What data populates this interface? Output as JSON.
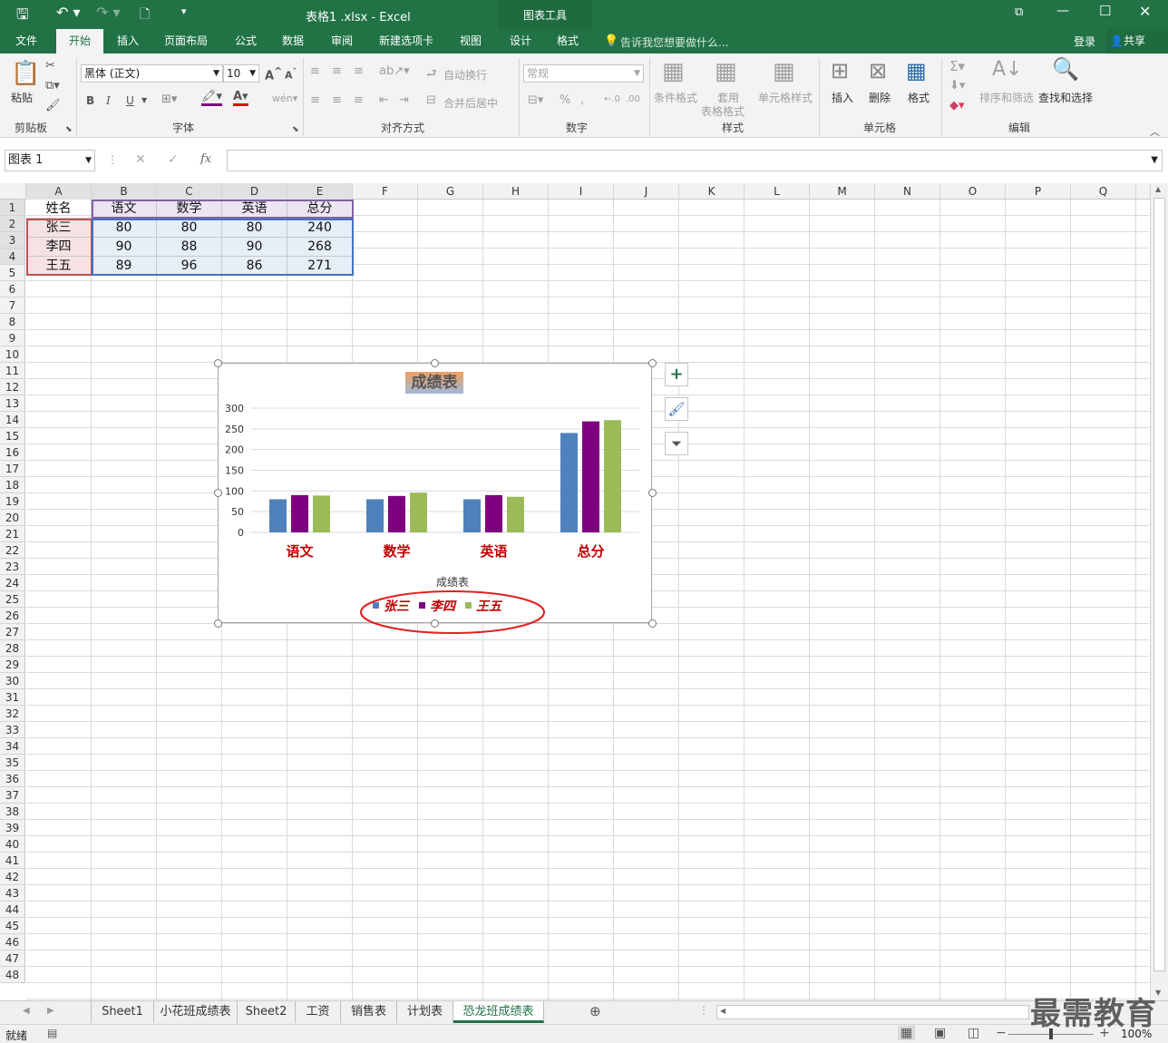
{
  "window": {
    "title": "表格1 .xlsx - Excel",
    "context_tools": "图表工具",
    "signin": "登录",
    "share": "共享"
  },
  "tabs": [
    "文件",
    "开始",
    "插入",
    "页面布局",
    "公式",
    "数据",
    "审阅",
    "新建选项卡",
    "视图",
    "设计",
    "格式"
  ],
  "tell_me": "告诉我您想要做什么...",
  "ribbon": {
    "paste": "粘贴",
    "clipboard": "剪贴板",
    "font_name": "黑体 (正文)",
    "font_size": "10",
    "font": "字体",
    "wrap": "自动换行",
    "merge": "合并后居中",
    "alignment": "对齐方式",
    "number_format": "常规",
    "number": "数字",
    "cond_format": "条件格式",
    "table_format_1": "套用",
    "table_format_2": "表格格式",
    "cell_styles": "单元格样式",
    "styles": "样式",
    "insert": "插入",
    "delete": "删除",
    "format": "格式",
    "cells": "单元格",
    "sort_filter": "排序和筛选",
    "find_select": "查找和选择",
    "editing": "编辑",
    "bold": "B",
    "italic": "I",
    "underline": "U"
  },
  "formula_bar": {
    "name_box": "图表 1",
    "fx": "fx",
    "content": ""
  },
  "columns": [
    "A",
    "B",
    "C",
    "D",
    "E",
    "F",
    "G",
    "H",
    "I",
    "J",
    "K",
    "L",
    "M",
    "N",
    "O",
    "P",
    "Q"
  ],
  "rows": [
    "1",
    "2",
    "3",
    "4",
    "5",
    "6",
    "7",
    "8",
    "9",
    "10",
    "11",
    "12",
    "13",
    "14",
    "15",
    "16",
    "17",
    "18",
    "19",
    "20",
    "21",
    "22",
    "23",
    "24",
    "25",
    "26",
    "27",
    "28",
    "29",
    "30",
    "31",
    "32",
    "33",
    "34",
    "35",
    "36",
    "37",
    "38",
    "39",
    "40",
    "41",
    "42",
    "43",
    "44",
    "45",
    "46",
    "47",
    "48"
  ],
  "table": {
    "header": [
      "姓名",
      "语文",
      "数学",
      "英语",
      "总分"
    ],
    "rows": [
      [
        "张三",
        "80",
        "80",
        "80",
        "240"
      ],
      [
        "李四",
        "90",
        "88",
        "90",
        "268"
      ],
      [
        "王五",
        "89",
        "96",
        "86",
        "271"
      ]
    ]
  },
  "chart_data": {
    "type": "bar",
    "title": "成绩表",
    "xlabel": "成绩表",
    "categories": [
      "语文",
      "数学",
      "英语",
      "总分"
    ],
    "series": [
      {
        "name": "张三",
        "values": [
          80,
          80,
          80,
          240
        ],
        "color": "#4f81bd"
      },
      {
        "name": "李四",
        "values": [
          90,
          88,
          90,
          268
        ],
        "color": "#7f007f"
      },
      {
        "name": "王五",
        "values": [
          89,
          96,
          86,
          271
        ],
        "color": "#9bbb59"
      }
    ],
    "yticks": [
      "300",
      "250",
      "200",
      "150",
      "100",
      "50",
      "0"
    ],
    "ylim": [
      0,
      300
    ],
    "grid": true,
    "legend_position": "bottom",
    "legend_highlight": "red-ellipse"
  },
  "sheets": [
    "Sheet1",
    "小花班成绩表",
    "Sheet2",
    "工资",
    "销售表",
    "计划表",
    "恐龙班成绩表"
  ],
  "active_sheet": "恐龙班成绩表",
  "status": {
    "ready": "就绪",
    "zoom": "100%"
  },
  "watermark": "最需教育",
  "colors": {
    "excel_green": "#217346",
    "header_fill": "#ece4f2",
    "data_fill": "#e6eef8",
    "name_fill": "#f6e2e4"
  }
}
